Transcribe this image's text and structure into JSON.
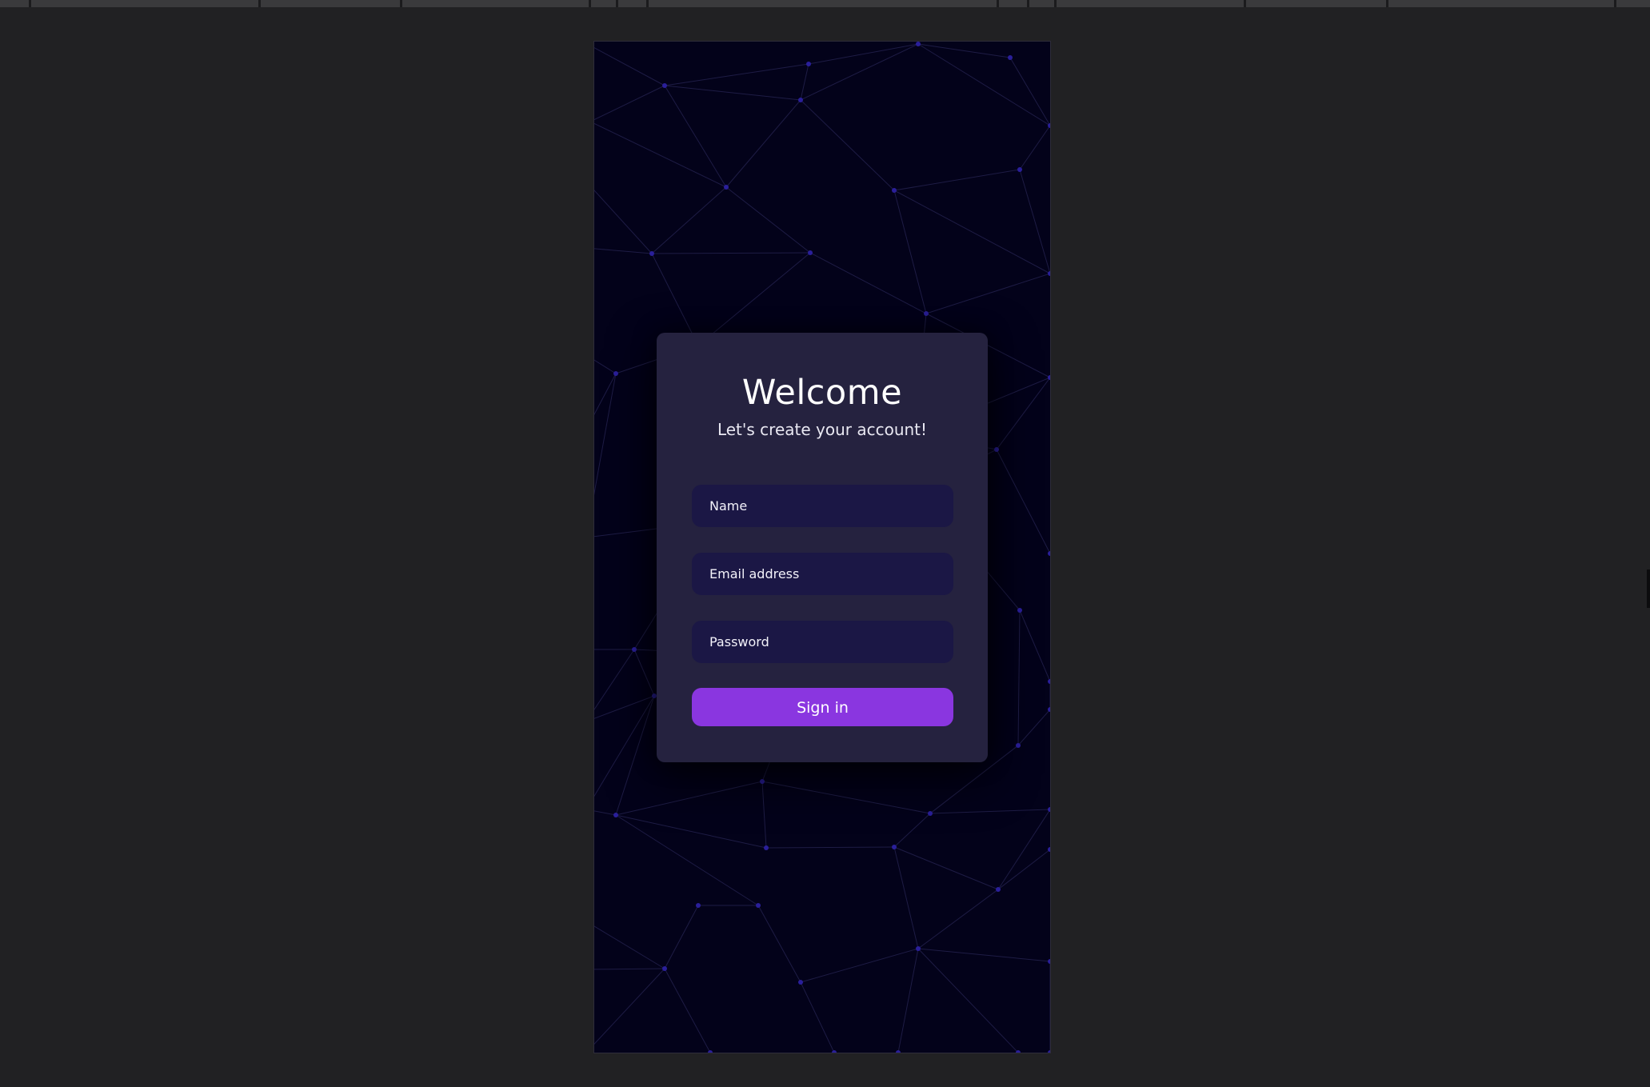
{
  "signup_card": {
    "title": "Welcome",
    "subtitle": "Let's create your account!",
    "name_placeholder": "Name",
    "email_placeholder": "Email address",
    "password_placeholder": "Password",
    "submit_label": "Sign in"
  },
  "colors": {
    "page_background": "#212123",
    "phone_background": "#03021a",
    "mesh_line": "#1e1c45",
    "mesh_node": "#2a1f9a",
    "card_background": "#25223f",
    "input_background": "#1b1745",
    "button_accent": "#8a36e0"
  }
}
